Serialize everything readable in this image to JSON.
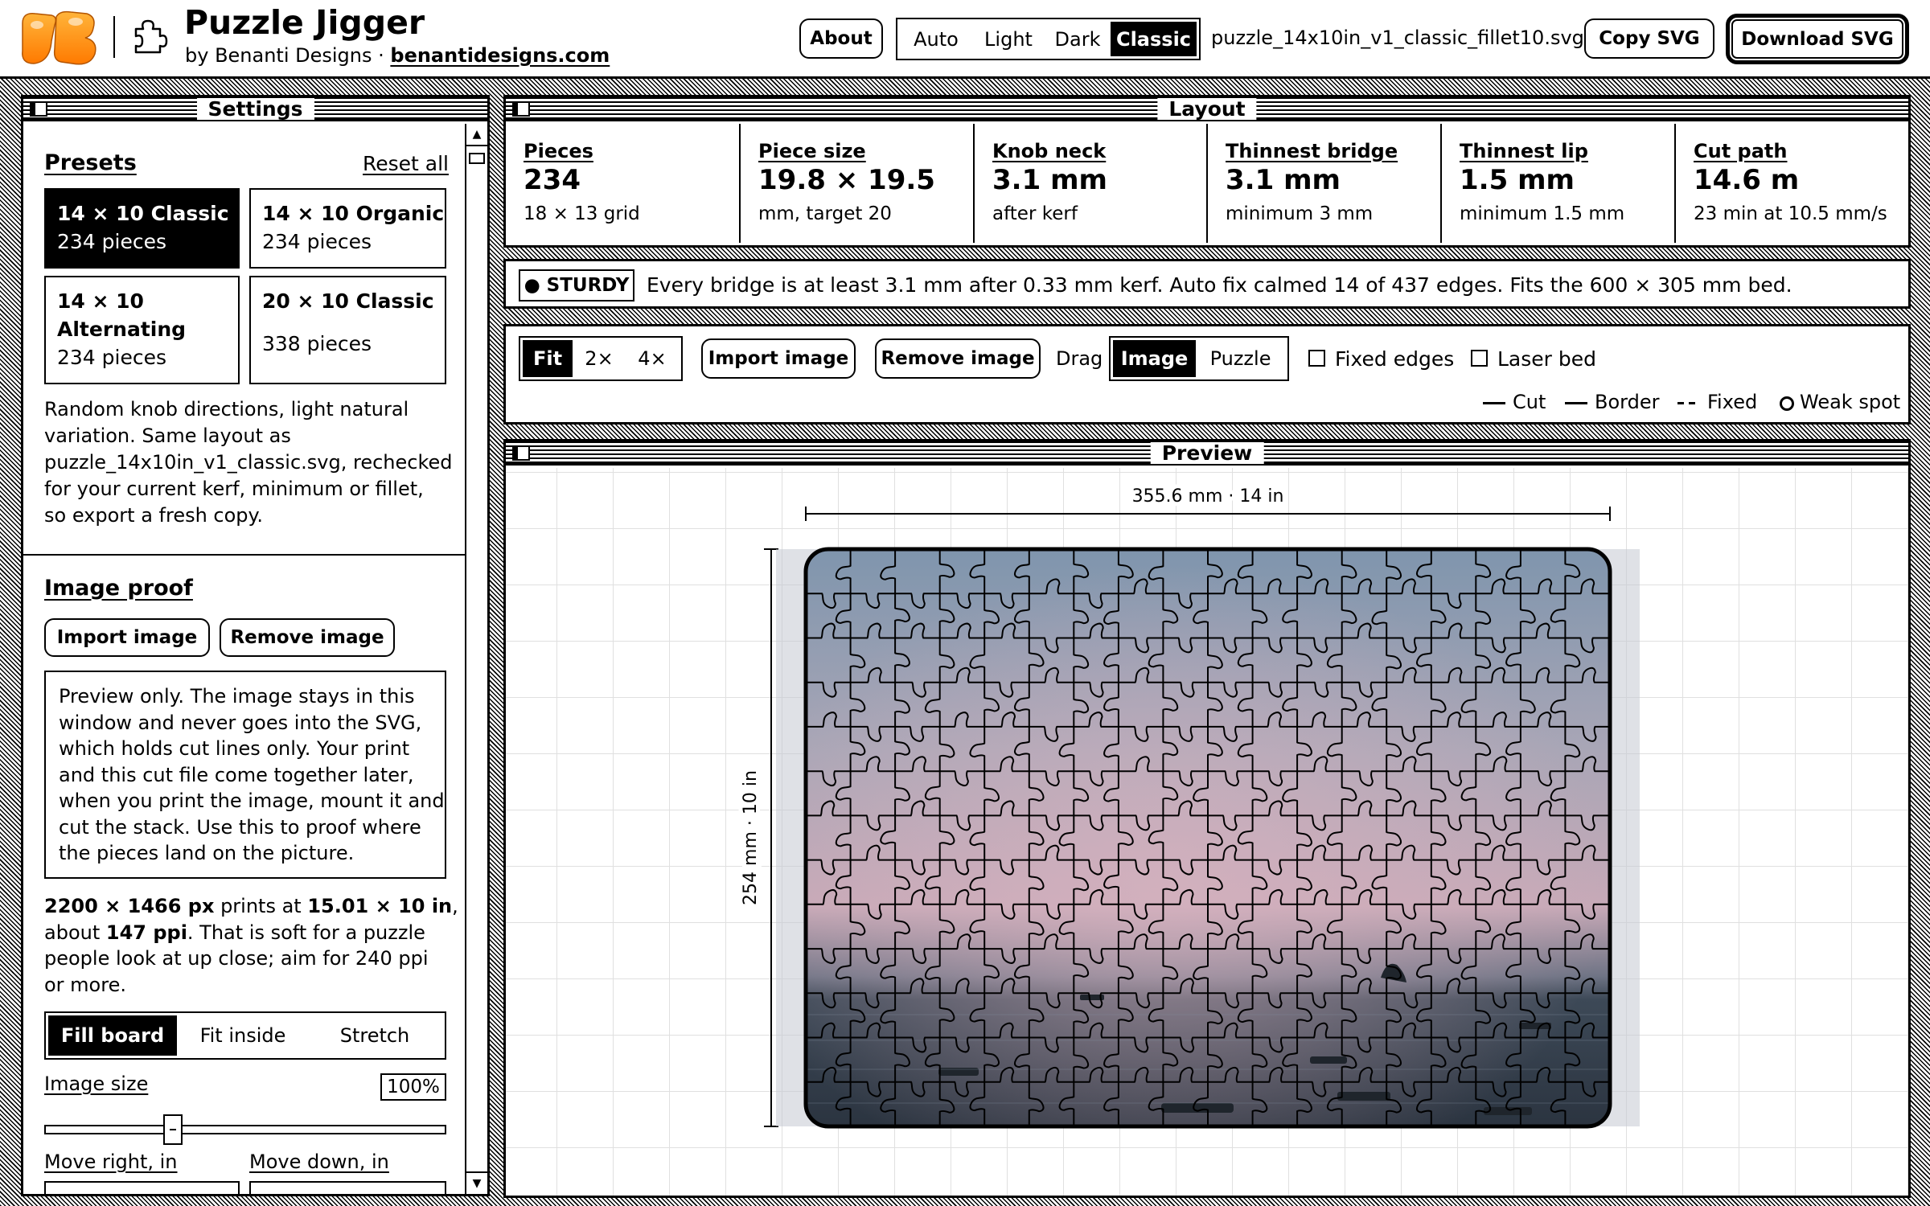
{
  "app": {
    "title": "Puzzle Jigger",
    "byline": "by Benanti Designs · ",
    "link": "benantidesigns.com"
  },
  "header": {
    "about": "About",
    "themes": [
      "Auto",
      "Light",
      "Dark",
      "Classic"
    ],
    "active_theme": "Classic",
    "filename": "puzzle_14x10in_v1_classic_fillet10.svg",
    "copy": "Copy SVG",
    "download": "Download SVG"
  },
  "settings": {
    "title": "Settings",
    "presets_heading": "Presets",
    "reset": "Reset all",
    "presets": [
      {
        "name": "14 × 10 Classic",
        "count": "234 pieces",
        "selected": true
      },
      {
        "name": "14 × 10 Organic",
        "count": "234 pieces",
        "selected": false
      },
      {
        "name_line1": "14 × 10",
        "name_line2": "Alternating",
        "count": "234 pieces",
        "selected": false
      },
      {
        "name": "20 × 10 Classic",
        "count": "338 pieces",
        "selected": false
      }
    ],
    "preset_note": [
      "Random knob directions, light natural",
      "variation. Same layout as",
      "puzzle_14x10in_v1_classic.svg, rechecked",
      "for your current kerf, minimum or fillet,",
      "so export a fresh copy."
    ],
    "image_proof_heading": "Image proof",
    "import": "Import image",
    "remove": "Remove image",
    "proof_note": [
      "Preview only. The image stays in this",
      "window and never goes into the SVG,",
      "which holds cut lines only. Your print",
      "and this cut file come together later,",
      "when you print the image, mount it and",
      "cut the stack. Use this to proof where",
      "the pieces land on the picture."
    ],
    "res": {
      "px": "2200 × 1466 px",
      "t1": " prints at ",
      "inches": "15.01 × 10 in",
      "t2": ",",
      "t3": "about ",
      "ppi": "147 ppi",
      "t4": ". That is soft for a puzzle",
      "line3": "people look at up close; aim for 240 ppi",
      "line4": "or more."
    },
    "fit_modes": [
      "Fill board",
      "Fit inside",
      "Stretch"
    ],
    "active_fit": "Fill board",
    "image_size_label": "Image size",
    "image_size_value": "100%",
    "image_size_fraction": 0.32,
    "move_right": "Move right, in",
    "move_down": "Move down, in"
  },
  "layout": {
    "title": "Layout",
    "stats": [
      {
        "label": "Pieces",
        "value": "234",
        "sub": "18 × 13 grid"
      },
      {
        "label": "Piece size",
        "value": "19.8 × 19.5",
        "sub": "mm, target 20"
      },
      {
        "label": "Knob neck",
        "value": "3.1 mm",
        "sub": "after kerf"
      },
      {
        "label": "Thinnest bridge",
        "value": "3.1 mm",
        "sub": "minimum 3 mm"
      },
      {
        "label": "Thinnest lip",
        "value": "1.5 mm",
        "sub": "minimum 1.5 mm"
      },
      {
        "label": "Cut path",
        "value": "14.6 m",
        "sub": "23 min at 10.5 mm/s"
      }
    ],
    "badge": "● STURDY",
    "status": "Every bridge is at least 3.1 mm after 0.33 mm kerf. Auto fix calmed 14 of 437 edges. Fits the 600 × 305 mm bed."
  },
  "toolbar": {
    "zoom": [
      "Fit",
      "2×",
      "4×"
    ],
    "active_zoom": "Fit",
    "import": "Import image",
    "remove": "Remove image",
    "drag_label": "Drag",
    "drag_modes": [
      "Image",
      "Puzzle"
    ],
    "active_drag": "Image",
    "fixed_edges": "Fixed edges",
    "laser_bed": "Laser bed",
    "legend": {
      "cut": "Cut",
      "border": "Border",
      "fixed": "Fixed",
      "weak": "Weak spot"
    }
  },
  "preview": {
    "title": "Preview",
    "width_label": "355.6 mm · 14 in",
    "height_label": "254 mm · 10 in",
    "cols": 18,
    "rows": 13,
    "colors": {
      "sky_top": "#7f95ad",
      "sky_mid": "#a9a6b6",
      "glow": "#c7a9b7",
      "horizon": "#6f7485",
      "sea": "#3d4957",
      "sea_dark": "#2b3440"
    }
  }
}
